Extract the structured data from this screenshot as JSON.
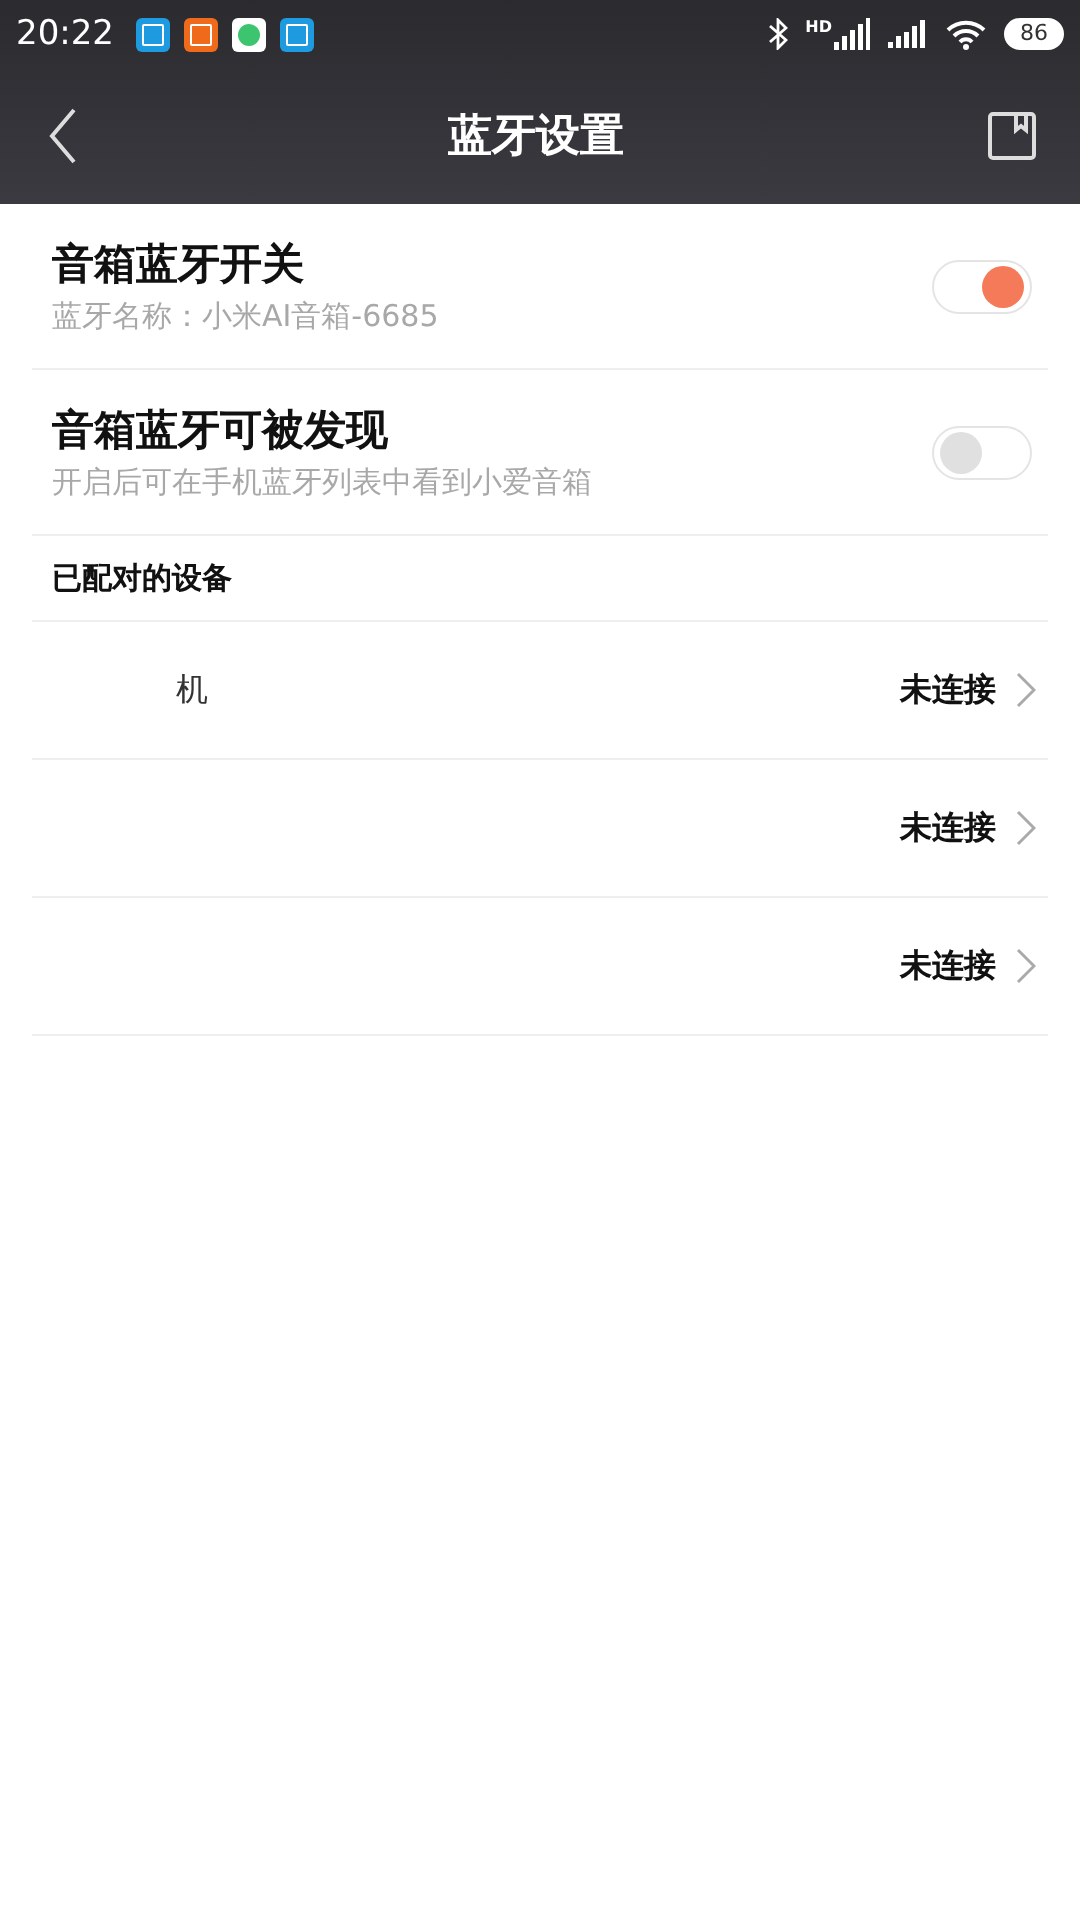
{
  "status_bar": {
    "time": "20:22",
    "battery": "86",
    "signal_badge": "HD"
  },
  "header": {
    "title": "蓝牙设置"
  },
  "settings": [
    {
      "title": "音箱蓝牙开关",
      "subtitle": "蓝牙名称：小米AI音箱-6685",
      "on": true
    },
    {
      "title": "音箱蓝牙可被发现",
      "subtitle": "开启后可在手机蓝牙列表中看到小爱音箱",
      "on": false
    }
  ],
  "paired_section": {
    "title": "已配对的设备"
  },
  "devices": [
    {
      "name": "机",
      "status": "未连接"
    },
    {
      "status": "未连接"
    },
    {
      "status": "未连接"
    }
  ]
}
